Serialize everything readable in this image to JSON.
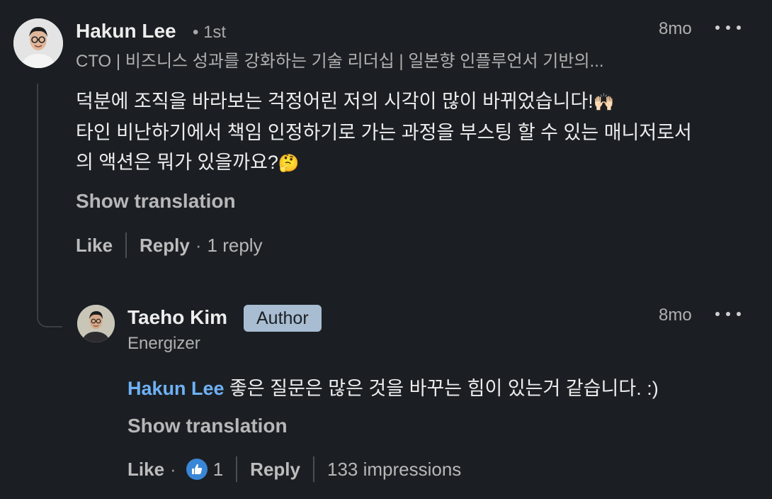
{
  "comment": {
    "author_name": "Hakun Lee",
    "connection_degree": "• 1st",
    "headline": "CTO | 비즈니스 성과를 강화하는 기술 리더십 | 일본향 인플루언서 기반의...",
    "time": "8mo",
    "body_line1": "덕분에 조직을 바라보는 걱정어린 저의 시각이 많이 바뀌었습니다!",
    "body_line1_emoji": "🙌🏻",
    "body_line2": "타인 비난하기에서 책임 인정하기로 가는 과정을 부스팅 할 수 있는 매니저로서",
    "body_line3": "의 액션은 뭐가 있을까요?",
    "body_line3_emoji": "🤔",
    "show_translation": "Show translation",
    "like_label": "Like",
    "reply_label": "Reply",
    "reply_count": "1 reply"
  },
  "reply": {
    "author_name": "Taeho Kim",
    "badge": "Author",
    "headline": "Energizer",
    "time": "8mo",
    "mention": "Hakun Lee",
    "body": " 좋은 질문은 많은 것을 바꾸는 힘이 있는거 같습니다. :)",
    "show_translation": "Show translation",
    "like_label": "Like",
    "reaction_count": "1",
    "reply_label": "Reply",
    "impressions": "133 impressions"
  },
  "icons": {
    "more": "more-horizontal-icon",
    "reaction": "thumbs-up-reaction-icon"
  },
  "colors": {
    "background": "#1b1f23",
    "mention": "#6fb1f5",
    "badge": "#a8bcd2",
    "reaction": "#3a86d6"
  }
}
